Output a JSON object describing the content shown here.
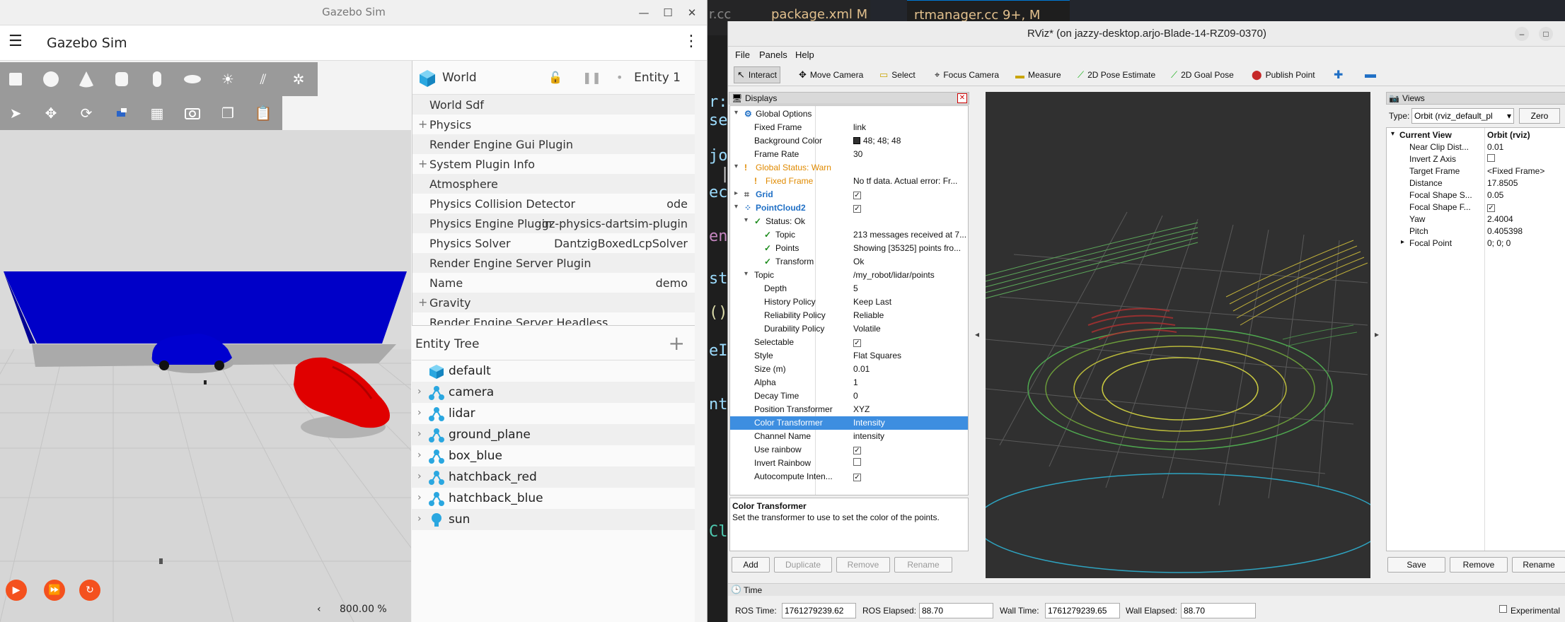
{
  "gazebo": {
    "window_title": "Gazebo Sim",
    "app_title": "Gazebo Sim",
    "zoom": "800.00 %",
    "component_inspector": {
      "entity_name": "World",
      "entity_id": "Entity 1",
      "rows": [
        {
          "label": "World Sdf",
          "value": "",
          "expandable": false
        },
        {
          "label": "Physics",
          "value": "",
          "expandable": true
        },
        {
          "label": "Render Engine Gui Plugin",
          "value": "",
          "expandable": false
        },
        {
          "label": "System Plugin Info",
          "value": "",
          "expandable": true
        },
        {
          "label": "Atmosphere",
          "value": "",
          "expandable": false
        },
        {
          "label": "Physics Collision Detector",
          "value": "ode",
          "expandable": false
        },
        {
          "label": "Physics Engine Plugin",
          "value": "gz-physics-dartsim-plugin",
          "expandable": false
        },
        {
          "label": "Physics Solver",
          "value": "DantzigBoxedLcpSolver",
          "expandable": false
        },
        {
          "label": "Render Engine Server Plugin",
          "value": "",
          "expandable": false
        },
        {
          "label": "Name",
          "value": "demo",
          "expandable": false
        },
        {
          "label": "Gravity",
          "value": "",
          "expandable": true
        },
        {
          "label": "Render Engine Server Headless",
          "value": "",
          "expandable": false
        }
      ]
    },
    "entity_tree": {
      "title": "Entity Tree",
      "items": [
        {
          "label": "default",
          "icon": "cube-icon",
          "expandable": false
        },
        {
          "label": "camera",
          "icon": "model-icon",
          "expandable": true
        },
        {
          "label": "lidar",
          "icon": "model-icon",
          "expandable": true
        },
        {
          "label": "ground_plane",
          "icon": "model-icon",
          "expandable": true
        },
        {
          "label": "box_blue",
          "icon": "model-icon",
          "expandable": true
        },
        {
          "label": "hatchback_red",
          "icon": "model-icon",
          "expandable": true
        },
        {
          "label": "hatchback_blue",
          "icon": "model-icon",
          "expandable": true
        },
        {
          "label": "sun",
          "icon": "lightbulb-icon",
          "expandable": true
        }
      ]
    }
  },
  "vscode": {
    "tabs": [
      {
        "label": "r.cc"
      },
      {
        "label": "package.xml M"
      },
      {
        "label": "rtmanager.cc 9+, M"
      }
    ],
    "code_fragments": [
      "r:",
      "se",
      "jo",
      "|",
      "ec",
      "end",
      "sta",
      "()",
      "eI",
      "nte",
      "Cl"
    ]
  },
  "rviz": {
    "window_title": "RViz* (on jazzy-desktop.arjo-Blade-14-RZ09-0370)",
    "menu": [
      "File",
      "Panels",
      "Help"
    ],
    "tools": [
      "Interact",
      "Move Camera",
      "Select",
      "Focus Camera",
      "Measure",
      "2D Pose Estimate",
      "2D Goal Pose",
      "Publish Point"
    ],
    "displays_title": "Displays",
    "displays": [
      {
        "name": "Global Options",
        "value": "",
        "depth": 0,
        "expander": "▾",
        "icon": "gear-icon",
        "style": ""
      },
      {
        "name": "Fixed Frame",
        "value": "link",
        "depth": 1,
        "expander": "",
        "icon": "",
        "style": ""
      },
      {
        "name": "Background Color",
        "value": "48; 48; 48",
        "depth": 1,
        "expander": "",
        "icon": "",
        "style": "swatch"
      },
      {
        "name": "Frame Rate",
        "value": "30",
        "depth": 1,
        "expander": "",
        "icon": "",
        "style": ""
      },
      {
        "name": "Global Status: Warn",
        "value": "",
        "depth": 0,
        "expander": "▾",
        "icon": "warning-icon",
        "style": "warn"
      },
      {
        "name": "Fixed Frame",
        "value": "No tf data.  Actual error: Fr...",
        "depth": 1,
        "expander": "",
        "icon": "warning-icon",
        "style": "warn"
      },
      {
        "name": "Grid",
        "value": "✓",
        "depth": 0,
        "expander": "▸",
        "icon": "grid-icon",
        "style": "blue"
      },
      {
        "name": "PointCloud2",
        "value": "✓",
        "depth": 0,
        "expander": "▾",
        "icon": "pointcloud-icon",
        "style": "blue"
      },
      {
        "name": "Status: Ok",
        "value": "",
        "depth": 1,
        "expander": "▾",
        "icon": "check-icon",
        "style": ""
      },
      {
        "name": "Topic",
        "value": "213 messages received at 7...",
        "depth": 2,
        "expander": "",
        "icon": "check-icon",
        "style": ""
      },
      {
        "name": "Points",
        "value": "Showing [35325] points fro...",
        "depth": 2,
        "expander": "",
        "icon": "check-icon",
        "style": ""
      },
      {
        "name": "Transform",
        "value": "Ok",
        "depth": 2,
        "expander": "",
        "icon": "check-icon",
        "style": ""
      },
      {
        "name": "Topic",
        "value": "/my_robot/lidar/points",
        "depth": 1,
        "expander": "▾",
        "icon": "",
        "style": ""
      },
      {
        "name": "Depth",
        "value": "5",
        "depth": 2,
        "expander": "",
        "icon": "",
        "style": ""
      },
      {
        "name": "History Policy",
        "value": "Keep Last",
        "depth": 2,
        "expander": "",
        "icon": "",
        "style": ""
      },
      {
        "name": "Reliability Policy",
        "value": "Reliable",
        "depth": 2,
        "expander": "",
        "icon": "",
        "style": ""
      },
      {
        "name": "Durability Policy",
        "value": "Volatile",
        "depth": 2,
        "expander": "",
        "icon": "",
        "style": ""
      },
      {
        "name": "Selectable",
        "value": "✓",
        "depth": 1,
        "expander": "",
        "icon": "",
        "style": ""
      },
      {
        "name": "Style",
        "value": "Flat Squares",
        "depth": 1,
        "expander": "",
        "icon": "",
        "style": ""
      },
      {
        "name": "Size (m)",
        "value": "0.01",
        "depth": 1,
        "expander": "",
        "icon": "",
        "style": ""
      },
      {
        "name": "Alpha",
        "value": "1",
        "depth": 1,
        "expander": "",
        "icon": "",
        "style": ""
      },
      {
        "name": "Decay Time",
        "value": "0",
        "depth": 1,
        "expander": "",
        "icon": "",
        "style": ""
      },
      {
        "name": "Position Transformer",
        "value": "XYZ",
        "depth": 1,
        "expander": "",
        "icon": "",
        "style": ""
      },
      {
        "name": "Color Transformer",
        "value": "Intensity",
        "depth": 1,
        "expander": "",
        "icon": "",
        "style": "selected"
      },
      {
        "name": "Channel Name",
        "value": "intensity",
        "depth": 1,
        "expander": "",
        "icon": "",
        "style": ""
      },
      {
        "name": "Use rainbow",
        "value": "✓",
        "depth": 1,
        "expander": "",
        "icon": "",
        "style": ""
      },
      {
        "name": "Invert Rainbow",
        "value": "☐",
        "depth": 1,
        "expander": "",
        "icon": "",
        "style": ""
      },
      {
        "name": "Autocompute Inten...",
        "value": "✓",
        "depth": 1,
        "expander": "",
        "icon": "",
        "style": ""
      }
    ],
    "description": {
      "title": "Color Transformer",
      "body": "Set the transformer to use to set the color of the points."
    },
    "display_buttons": [
      "Add",
      "Duplicate",
      "Remove",
      "Rename"
    ],
    "views": {
      "title": "Views",
      "type_label": "Type:",
      "type_value": "Orbit (rviz_default_pl",
      "zero_label": "Zero",
      "rows": [
        {
          "name": "Current View",
          "value": "Orbit (rviz)",
          "depth": 0,
          "expander": "▾",
          "bold": true
        },
        {
          "name": "Near Clip Dist...",
          "value": "0.01",
          "depth": 1,
          "expander": "",
          "bold": false
        },
        {
          "name": "Invert Z Axis",
          "value": "☐",
          "depth": 1,
          "expander": "",
          "bold": false
        },
        {
          "name": "Target Frame",
          "value": "<Fixed Frame>",
          "depth": 1,
          "expander": "",
          "bold": false
        },
        {
          "name": "Distance",
          "value": "17.8505",
          "depth": 1,
          "expander": "",
          "bold": false
        },
        {
          "name": "Focal Shape S...",
          "value": "0.05",
          "depth": 1,
          "expander": "",
          "bold": false
        },
        {
          "name": "Focal Shape F...",
          "value": "✓",
          "depth": 1,
          "expander": "",
          "bold": false
        },
        {
          "name": "Yaw",
          "value": "2.4004",
          "depth": 1,
          "expander": "",
          "bold": false
        },
        {
          "name": "Pitch",
          "value": "0.405398",
          "depth": 1,
          "expander": "",
          "bold": false
        },
        {
          "name": "Focal Point",
          "value": "0; 0; 0",
          "depth": 1,
          "expander": "▸",
          "bold": false
        }
      ],
      "buttons": [
        "Save",
        "Remove",
        "Rename"
      ]
    },
    "time": {
      "title": "Time",
      "ros_time_label": "ROS Time:",
      "ros_time": "1761279239.62",
      "ros_elapsed_label": "ROS Elapsed:",
      "ros_elapsed": "88.70",
      "wall_time_label": "Wall Time:",
      "wall_time": "1761279239.65",
      "wall_elapsed_label": "Wall Elapsed:",
      "wall_elapsed": "88.70",
      "experimental_label": "Experimental"
    }
  },
  "colors": {
    "gazebo_accent": "#f4511e",
    "rviz_selection": "#3d8ee0",
    "rviz_background": "#303030",
    "box_blue": "#0000c8",
    "hatchback_red": "#e00000"
  }
}
